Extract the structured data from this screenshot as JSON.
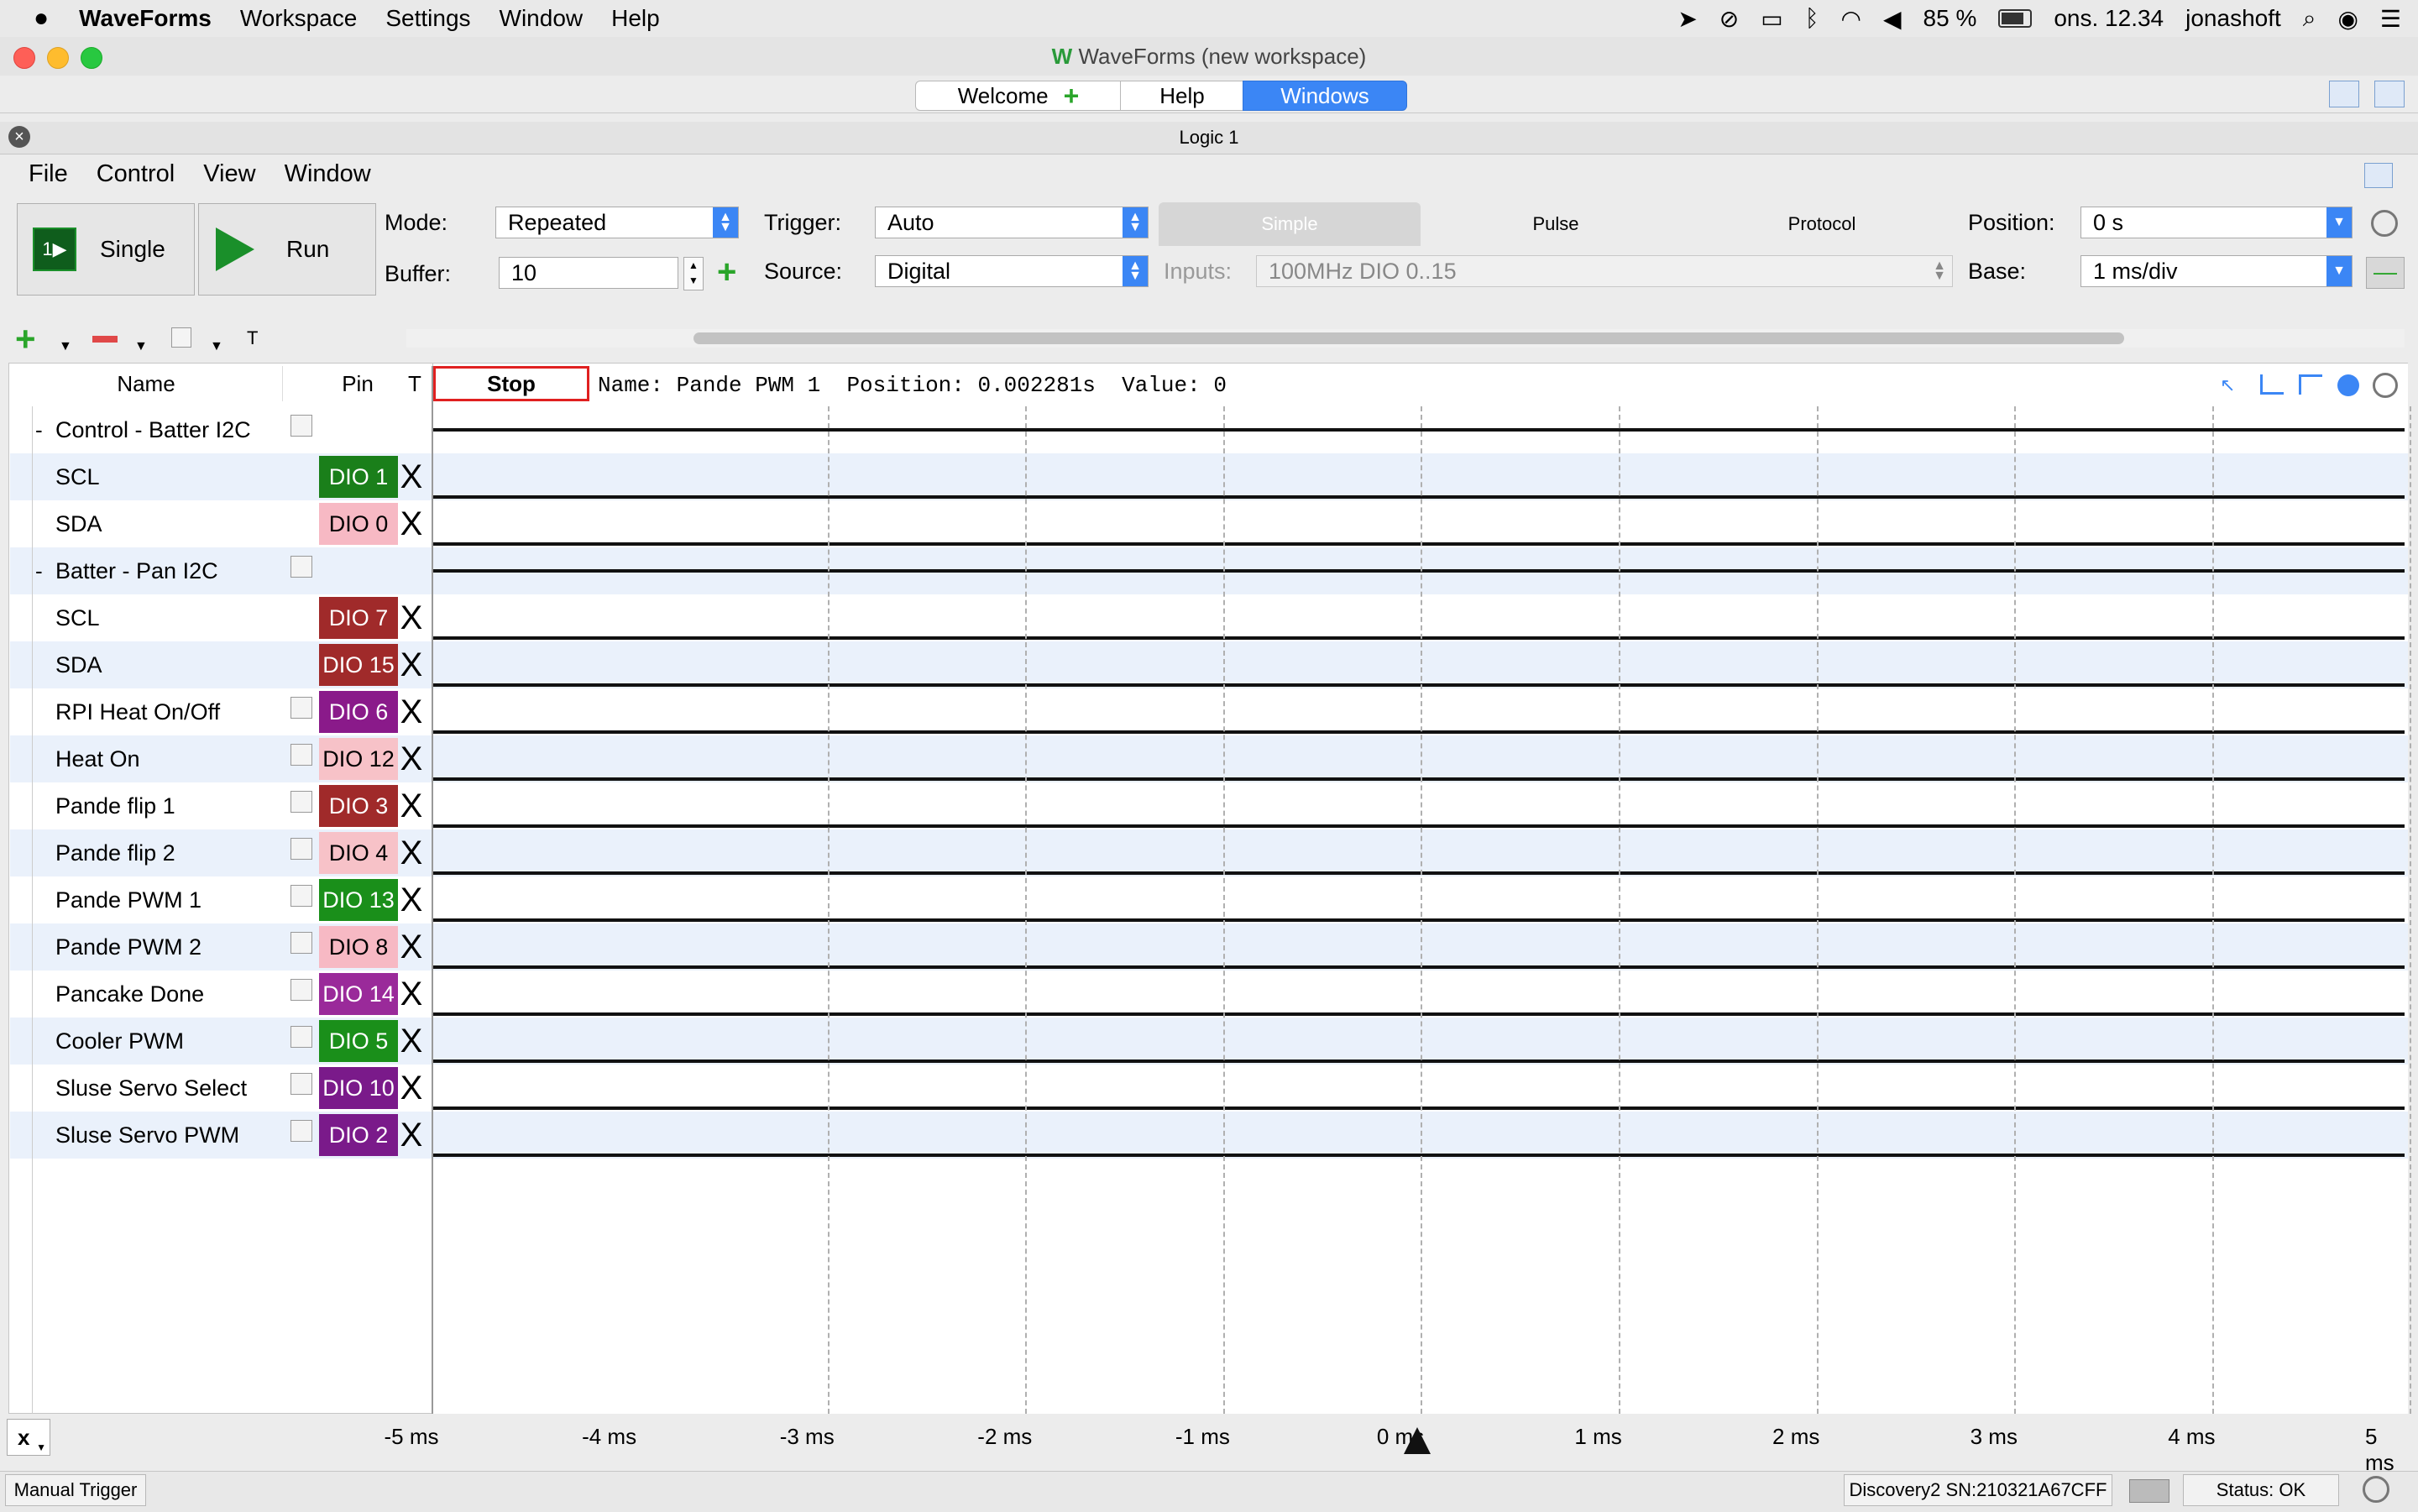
{
  "menubar": {
    "apple": "",
    "app": "WaveForms",
    "items": [
      "Workspace",
      "Settings",
      "Window",
      "Help"
    ],
    "battery": "85 %",
    "time": "ons. 12.34",
    "user": "jonashoft"
  },
  "window": {
    "title": "WaveForms (new workspace)",
    "tabs": {
      "welcome": "Welcome",
      "help": "Help",
      "windows": "Windows"
    }
  },
  "document": {
    "title": "Logic 1",
    "menu": [
      "File",
      "Control",
      "View",
      "Window"
    ]
  },
  "toolbar": {
    "single": "Single",
    "run": "Run",
    "mode_label": "Mode:",
    "mode_value": "Repeated",
    "buffer_label": "Buffer:",
    "buffer_value": "10",
    "trigger_label": "Trigger:",
    "trigger_value": "Auto",
    "source_label": "Source:",
    "source_value": "Digital",
    "tabs": {
      "simple": "Simple",
      "pulse": "Pulse",
      "protocol": "Protocol"
    },
    "inputs_label": "Inputs:",
    "inputs_value": "100MHz DIO 0..15",
    "position_label": "Position:",
    "position_value": "0 s",
    "base_label": "Base:",
    "base_value": "1 ms/div",
    "t_label": "T"
  },
  "table": {
    "headers": {
      "name": "Name",
      "pin": "Pin",
      "t": "T"
    },
    "stop": "Stop",
    "info": "Name: Pande PWM 1  Position: 0.002281s  Value: 0",
    "rows": [
      {
        "name": "Control - Batter I2C",
        "group": true,
        "pin": "",
        "color": "#ffffff",
        "text": "#000000"
      },
      {
        "name": "SCL",
        "group": false,
        "pin": "DIO  1",
        "color": "#1a7f1a",
        "text": "#ffffff"
      },
      {
        "name": "SDA",
        "group": false,
        "pin": "DIO  0",
        "color": "#f7b9c4",
        "text": "#000000"
      },
      {
        "name": "Batter - Pan I2C",
        "group": true,
        "pin": "",
        "color": "#ffffff",
        "text": "#000000"
      },
      {
        "name": "SCL",
        "group": false,
        "pin": "DIO  7",
        "color": "#a02a2a",
        "text": "#ffffff"
      },
      {
        "name": "SDA",
        "group": false,
        "pin": "DIO 15",
        "color": "#a02a2a",
        "text": "#ffffff"
      },
      {
        "name": "RPI Heat On/Off",
        "group": false,
        "pin": "DIO  6",
        "color": "#8a1a8a",
        "text": "#ffffff"
      },
      {
        "name": "Heat On",
        "group": false,
        "pin": "DIO 12",
        "color": "#f7c2c8",
        "text": "#000000"
      },
      {
        "name": "Pande flip 1",
        "group": false,
        "pin": "DIO  3",
        "color": "#a02a2a",
        "text": "#ffffff"
      },
      {
        "name": "Pande flip 2",
        "group": false,
        "pin": "DIO  4",
        "color": "#f7c2c8",
        "text": "#000000"
      },
      {
        "name": "Pande PWM 1",
        "group": false,
        "pin": "DIO 13",
        "color": "#1a8f1a",
        "text": "#ffffff"
      },
      {
        "name": "Pande PWM 2",
        "group": false,
        "pin": "DIO  8",
        "color": "#f7b9c4",
        "text": "#000000"
      },
      {
        "name": "Pancake Done",
        "group": false,
        "pin": "DIO 14",
        "color": "#9a2a9a",
        "text": "#ffffff"
      },
      {
        "name": "Cooler PWM",
        "group": false,
        "pin": "DIO  5",
        "color": "#1a8f1a",
        "text": "#ffffff"
      },
      {
        "name": "Sluse Servo Select",
        "group": false,
        "pin": "DIO 10",
        "color": "#7a1a8a",
        "text": "#ffffff"
      },
      {
        "name": "Sluse Servo PWM",
        "group": false,
        "pin": "DIO  2",
        "color": "#7a1a8a",
        "text": "#ffffff"
      }
    ],
    "x_mark": "X"
  },
  "axis": {
    "ticks": [
      "-5 ms",
      "-4 ms",
      "-3 ms",
      "-2 ms",
      "-1 ms",
      "0 ms",
      "1 ms",
      "2 ms",
      "3 ms",
      "4 ms",
      "5 ms"
    ]
  },
  "bottom": {
    "x_button": "x",
    "manual_trigger": "Manual Trigger",
    "device": "Discovery2 SN:210321A67CFF",
    "status": "Status: OK"
  },
  "colors": {
    "accent": "#3b86f5",
    "row_alt": "#eaf1fb",
    "stop_border": "#e02020"
  }
}
